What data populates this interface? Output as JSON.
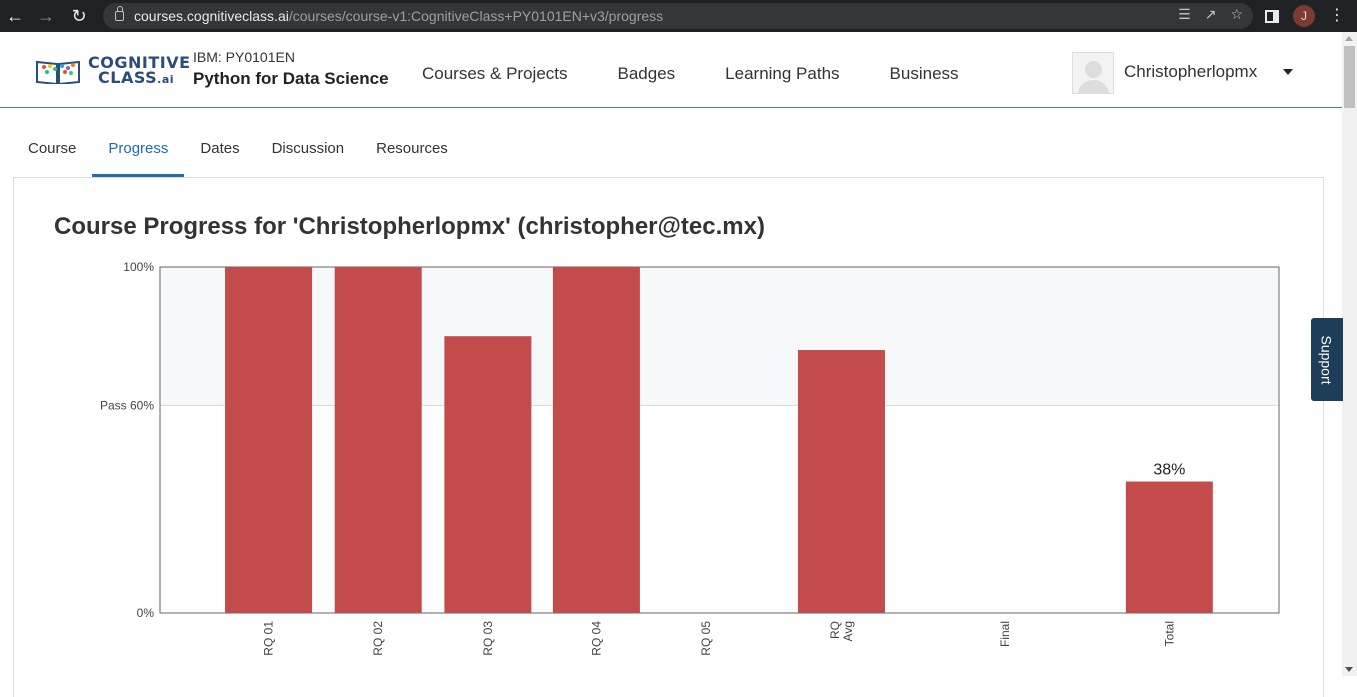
{
  "browser": {
    "url_host": "courses.cognitiveclass.ai",
    "url_path": "/courses/course-v1:CognitiveClass+PY0101EN+v3/progress",
    "profile_initial": "J",
    "icons": [
      "back-icon",
      "forward-icon",
      "reload-icon",
      "translate-icon",
      "share-icon",
      "star-icon",
      "side-panel-icon",
      "menu-icon"
    ]
  },
  "header": {
    "logo_line1": "COGNITIVE",
    "logo_line2": "CLASS",
    "logo_suffix": ".ai",
    "course_code": "IBM: PY0101EN",
    "course_name": "Python for Data Science",
    "nav": [
      "Courses & Projects",
      "Badges",
      "Learning Paths",
      "Business"
    ],
    "username": "Christopherlopmx"
  },
  "tabs": [
    "Course",
    "Progress",
    "Dates",
    "Discussion",
    "Resources"
  ],
  "active_tab": "Progress",
  "page_title": "Course Progress for 'Christopherlopmx' (christopher@tec.mx)",
  "support_label": "Support",
  "colors": {
    "bar": "#c44b4b",
    "brand": "#2b4d7a",
    "active_tab": "#1f6bb0",
    "support": "#1e3d59",
    "pass_zone": "#f7f8fa"
  },
  "chart_data": {
    "type": "bar",
    "categories": [
      "RQ 01",
      "RQ 02",
      "RQ 03",
      "RQ 04",
      "RQ 05",
      "RQ Avg",
      "Final",
      "Total"
    ],
    "category_lines": [
      [
        "RQ 01"
      ],
      [
        "RQ 02"
      ],
      [
        "RQ 03"
      ],
      [
        "RQ 04"
      ],
      [
        "RQ 05"
      ],
      [
        "RQ",
        "Avg"
      ],
      [
        "Final"
      ],
      [
        "Total"
      ]
    ],
    "values": [
      100,
      100,
      80,
      100,
      0,
      76,
      0,
      38
    ],
    "ylim": [
      0,
      100
    ],
    "yticks": [
      {
        "value": 100,
        "label": "100%"
      },
      {
        "value": 60,
        "label": "Pass 60%"
      },
      {
        "value": 0,
        "label": "0%"
      }
    ],
    "pass_threshold": 60,
    "data_labels": [
      {
        "index": 7,
        "label": "38%"
      }
    ],
    "grid": false
  }
}
